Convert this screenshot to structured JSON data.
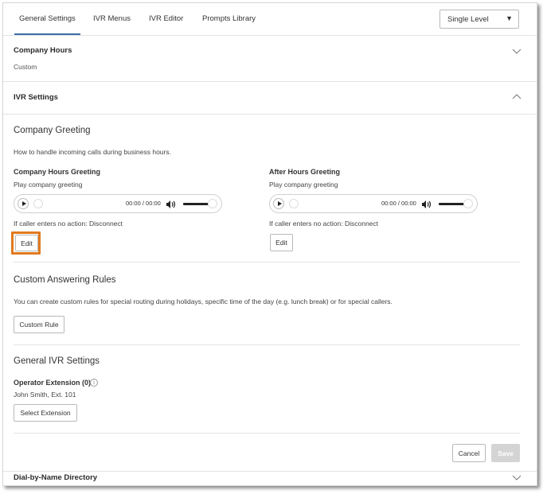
{
  "tabs": [
    {
      "label": "General Settings",
      "active": true
    },
    {
      "label": "IVR Menus"
    },
    {
      "label": "IVR Editor"
    },
    {
      "label": "Prompts Library"
    }
  ],
  "level_select": {
    "value": "Single Level"
  },
  "company_hours": {
    "title": "Company Hours",
    "value": "Custom"
  },
  "ivr_settings": {
    "title": "IVR Settings"
  },
  "company_greeting": {
    "heading": "Company Greeting",
    "description": "How to handle incoming calls during business hours.",
    "hours": {
      "label": "Company Hours Greeting",
      "sub": "Play company greeting",
      "time": "00:00 / 00:00",
      "no_action": "If caller enters no action: Disconnect",
      "edit": "Edit"
    },
    "after": {
      "label": "After Hours Greeting",
      "sub": "Play company greeting",
      "time": "00:00 / 00:00",
      "no_action": "If caller enters no action: Disconnect",
      "edit": "Edit"
    }
  },
  "custom_rules": {
    "heading": "Custom Answering Rules",
    "description": "You can create custom rules for special routing during holidays, specific time of the day (e.g. lunch break) or for special callers.",
    "button": "Custom Rule"
  },
  "general_ivr": {
    "heading": "General IVR Settings",
    "operator_label": "Operator Extension (0)",
    "operator_value": "John Smith, Ext. 101",
    "button": "Select Extension"
  },
  "footer": {
    "cancel": "Cancel",
    "save": "Save"
  },
  "dial_by_name": {
    "title": "Dial-by-Name Directory"
  },
  "colors": {
    "highlight": "#e07a1f",
    "tab_underline": "#3a6ea5"
  },
  "icons": [
    "chevron-down-icon",
    "chevron-up-icon",
    "play-icon",
    "volume-icon",
    "info-icon",
    "caret-down-icon"
  ]
}
